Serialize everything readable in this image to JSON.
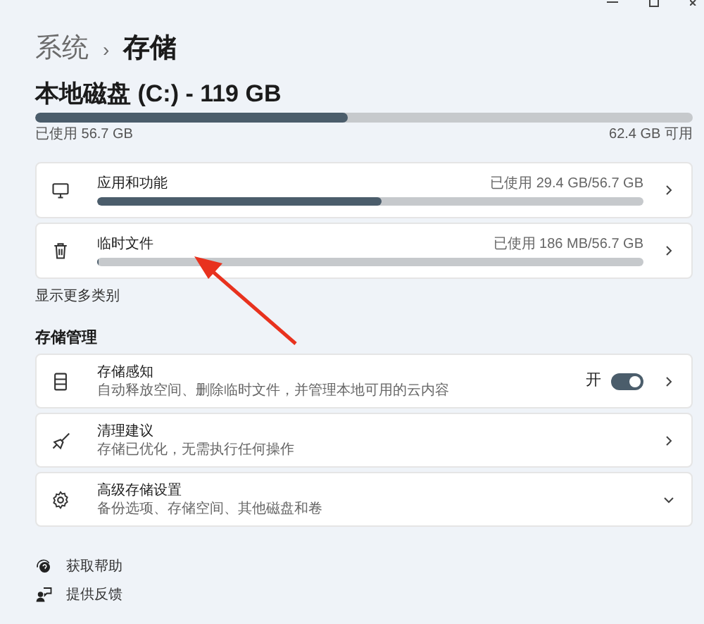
{
  "breadcrumb": {
    "parent": "系统",
    "separator": "›",
    "current": "存储"
  },
  "disk": {
    "title": "本地磁盘 (C:) - 119 GB",
    "level": 0.475,
    "used": "已使用 56.7 GB",
    "free": "62.4 GB 可用"
  },
  "categories": [
    {
      "name": "应用和功能",
      "usage": "已使用 29.4 GB/56.7 GB",
      "level": 0.52
    },
    {
      "name": "临时文件",
      "usage": "已使用 186 MB/56.7 GB",
      "level": 0.003
    }
  ],
  "show_more": "显示更多类别",
  "management": {
    "heading": "存储管理",
    "items": [
      {
        "kind": "toggle",
        "title": "存储感知",
        "subtitle": "自动释放空间、删除临时文件，并管理本地可用的云内容",
        "state_label": "开",
        "on": true
      },
      {
        "kind": "link",
        "title": "清理建议",
        "subtitle": "存储已优化，无需执行任何操作"
      },
      {
        "kind": "expand",
        "title": "高级存储设置",
        "subtitle": "备份选项、存储空间、其他磁盘和卷"
      }
    ]
  },
  "footer_links": [
    {
      "label": "获取帮助"
    },
    {
      "label": "提供反馈"
    }
  ]
}
